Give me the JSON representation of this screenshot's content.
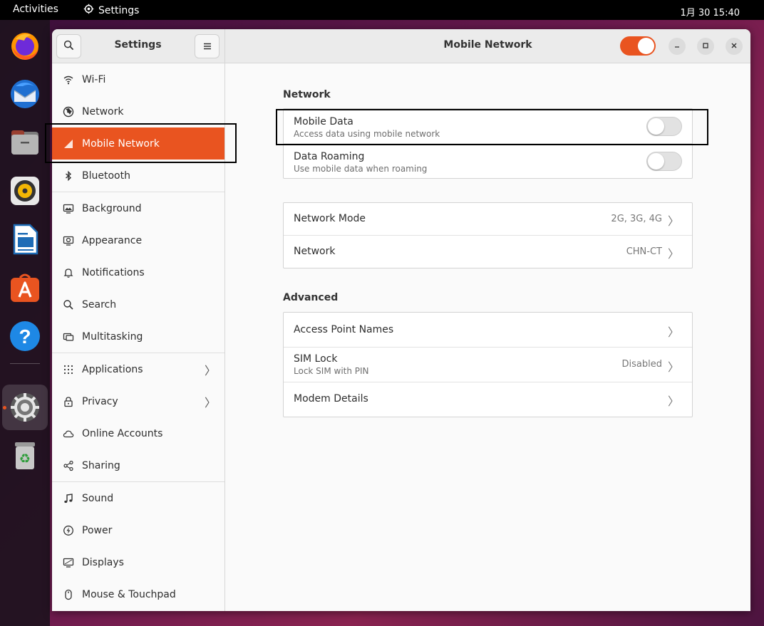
{
  "topbar": {
    "activities": "Activities",
    "app_name": "Settings",
    "clock": "1月 30  15:40"
  },
  "dock": {
    "items": [
      "firefox-icon",
      "thunderbird-icon",
      "files-icon",
      "rhythmbox-icon",
      "libreoffice-writer-icon",
      "app-center-icon",
      "help-icon",
      "settings-icon",
      "trash-icon"
    ]
  },
  "window": {
    "sidebar_title": "Settings",
    "main_title": "Mobile Network",
    "mobile_network_enabled": true
  },
  "sidebar": {
    "items": [
      {
        "label": "Wi-Fi",
        "icon": "wifi-icon"
      },
      {
        "label": "Network",
        "icon": "network-globe-icon"
      },
      {
        "label": "Mobile Network",
        "icon": "mobile-signal-icon",
        "active": true
      },
      {
        "label": "Bluetooth",
        "icon": "bluetooth-icon"
      },
      {
        "label": "Background",
        "icon": "background-icon"
      },
      {
        "label": "Appearance",
        "icon": "appearance-icon"
      },
      {
        "label": "Notifications",
        "icon": "bell-icon"
      },
      {
        "label": "Search",
        "icon": "search-icon"
      },
      {
        "label": "Multitasking",
        "icon": "multitasking-icon"
      },
      {
        "label": "Applications",
        "icon": "grid-icon",
        "chevron": true
      },
      {
        "label": "Privacy",
        "icon": "lock-icon",
        "chevron": true
      },
      {
        "label": "Online Accounts",
        "icon": "cloud-icon"
      },
      {
        "label": "Sharing",
        "icon": "share-icon"
      },
      {
        "label": "Sound",
        "icon": "music-note-icon"
      },
      {
        "label": "Power",
        "icon": "power-icon"
      },
      {
        "label": "Displays",
        "icon": "display-icon"
      },
      {
        "label": "Mouse & Touchpad",
        "icon": "mouse-icon"
      }
    ]
  },
  "content": {
    "network_section": {
      "title": "Network",
      "mobile_data": {
        "title": "Mobile Data",
        "subtitle": "Access data using mobile network",
        "enabled": false
      },
      "data_roaming": {
        "title": "Data Roaming",
        "subtitle": "Use mobile data when roaming",
        "enabled": false
      }
    },
    "mode_section": {
      "network_mode": {
        "title": "Network Mode",
        "value": "2G, 3G, 4G"
      },
      "network": {
        "title": "Network",
        "value": "CHN-CT"
      }
    },
    "advanced_section": {
      "title": "Advanced",
      "apn": {
        "title": "Access Point Names"
      },
      "sim_lock": {
        "title": "SIM Lock",
        "subtitle": "Lock SIM with PIN",
        "value": "Disabled"
      },
      "modem": {
        "title": "Modem Details"
      }
    }
  },
  "colors": {
    "accent": "#e95420",
    "topbar": "#000000"
  }
}
